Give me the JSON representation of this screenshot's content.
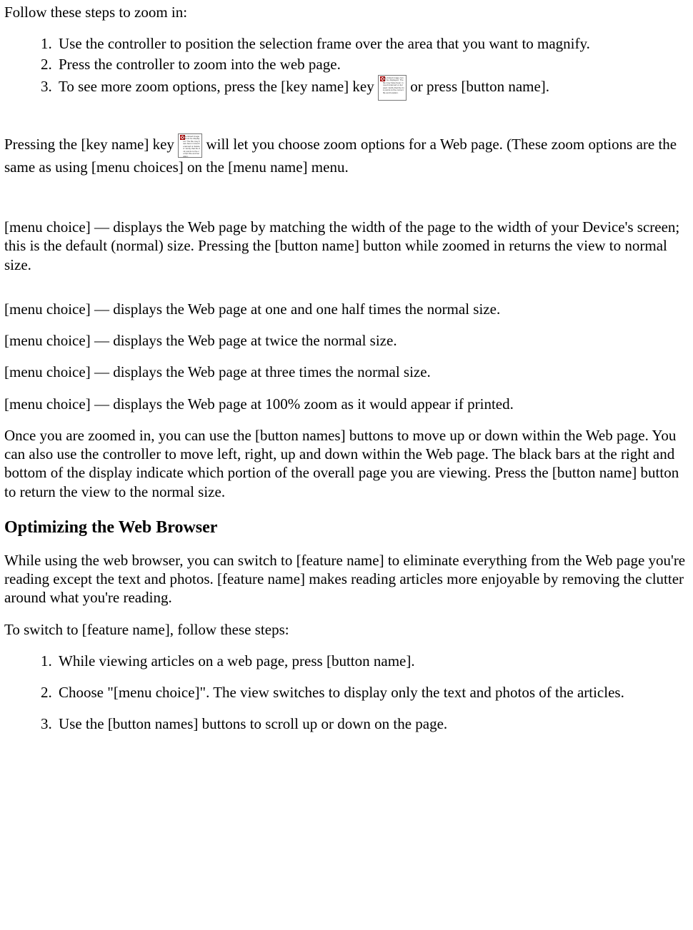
{
  "intro": "Follow these steps to zoom in:",
  "steps_zoom": [
    "Use the controller to position the selection frame over the area that you want to magnify.",
    "Press the controller to zoom into the web page.",
    {
      "pre": "To see more zoom options, press the [key name] key ",
      "post": " or press [button name]."
    }
  ],
  "key_para": {
    "pre": "Pressing the [key name] key ",
    "post": "will let you choose zoom options for a Web page. (These zoom options are the same as using [menu choices] on the [menu name] menu."
  },
  "menu_choice_intro": "[menu choice] — displays the Web page by matching the width of the page to the width of your Device's screen; this is the default (normal) size.  Pressing the [button name] button while zoomed in returns the view to normal size.",
  "menu_choices": [
    "[menu choice] — displays the Web page at one and one half times the normal size.",
    "[menu choice] — displays the Web page at twice the normal size.",
    "[menu choice] — displays the Web page at three times the normal size.",
    "[menu choice] — displays the Web page at 100% zoom as it would appear if printed."
  ],
  "zoom_nav": "Once you are zoomed in, you can use the [button names] buttons to move up or down within the Web page. You can also use the controller to move left, right, up and down within the Web page. The black bars at the right and bottom of the display indicate which portion of the overall page you are viewing. Press the [button name] button to return the view to the normal size.",
  "section_heading": "Optimizing the Web Browser",
  "optimize_p1": "While using the web browser, you can switch to [feature name] to eliminate everything from the Web page you're reading except the text and photos. [feature name] makes reading articles more enjoyable by removing the clutter around what you're reading.",
  "optimize_p2": "To switch to [feature name], follow these steps:",
  "steps_optimize": [
    "While viewing articles on a web page, press [button name].",
    "Choose \"[menu choice]\". The view switches to display only the text and photos of the articles.",
    "Use the [button names] buttons to scroll up or down on the page."
  ],
  "icon_filler": "The linked image cannot be displayed. The file may have been moved renamed or deleted. Verify that the link points to the correct file and location."
}
